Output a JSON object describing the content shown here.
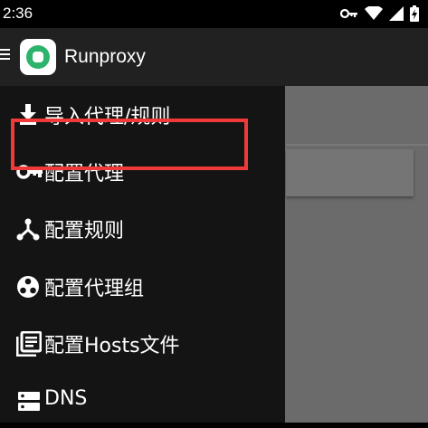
{
  "status_bar": {
    "time": "2:36",
    "icons": [
      "key-icon",
      "wifi-icon",
      "signal-icon",
      "battery-charging-icon"
    ]
  },
  "toolbar": {
    "title": "Runproxy",
    "menu_icon": "hamburger-icon",
    "logo_icon": "runproxy-logo"
  },
  "drawer": {
    "items": [
      {
        "label": "导入代理/规则",
        "icon": "download-icon"
      },
      {
        "label": "配置代理",
        "icon": "key-icon"
      },
      {
        "label": "配置规则",
        "icon": "fork-icon",
        "highlighted": true
      },
      {
        "label": "配置代理组",
        "icon": "group-circle-icon"
      },
      {
        "label": "配置Hosts文件",
        "icon": "library-books-icon"
      },
      {
        "label": "DNS",
        "icon": "dns-server-icon"
      }
    ]
  },
  "colors": {
    "highlight_border": "#f03a3a",
    "logo_green": "#2db36b",
    "drawer_bg": "#141414",
    "toolbar_bg": "#212121"
  }
}
